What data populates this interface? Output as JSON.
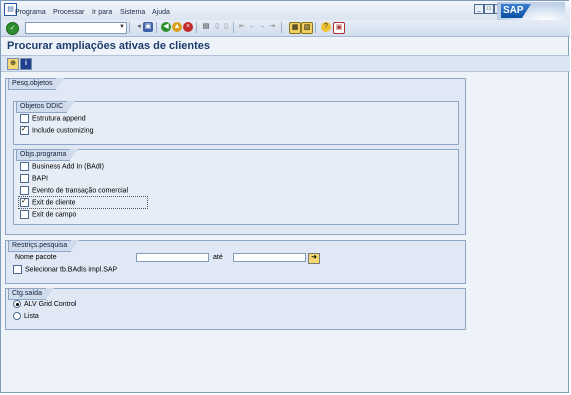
{
  "menubar": {
    "items": [
      {
        "id": "programa",
        "label": "Programa"
      },
      {
        "id": "processar",
        "label": "Processar"
      },
      {
        "id": "irpara",
        "label": "Ir para"
      },
      {
        "id": "sistema",
        "label": "Sistema"
      },
      {
        "id": "ajuda",
        "label": "Ajuda"
      }
    ],
    "logo_text": "SAP"
  },
  "systoolbar": {
    "command_value": "",
    "icons": [
      "enter-icon",
      "save-icon",
      "back-icon",
      "exit-icon",
      "cancel-icon",
      "print-icon",
      "find-icon",
      "find-next-icon",
      "first-page-icon",
      "prev-page-icon",
      "next-page-icon",
      "last-page-icon",
      "create-session-icon",
      "shortcut-icon",
      "help-icon",
      "customize-layout-icon"
    ]
  },
  "title": "Procurar ampliações ativas de clientes",
  "apptoolbar": {
    "icons": [
      "execute-icon",
      "information-icon"
    ]
  },
  "groups": {
    "pesq": {
      "label": "Pesq.objetos",
      "ddic": {
        "label": "Objetos DDIC",
        "options": [
          {
            "label": "Estrutura append",
            "checked": false
          },
          {
            "label": "Include customizing",
            "checked": true
          }
        ]
      },
      "prog": {
        "label": "Objs.programa",
        "options": [
          {
            "label": "Business Add In (BAdI)",
            "checked": false
          },
          {
            "label": "BAPI",
            "checked": false
          },
          {
            "label": "Evento de transação comercial",
            "checked": false
          },
          {
            "label": "Exit de cliente",
            "checked": true
          },
          {
            "label": "Exit de campo",
            "checked": false
          }
        ]
      }
    },
    "restr": {
      "label": "Restriçs.pesquisa",
      "field_label": "Nome pacote",
      "from_value": "",
      "to_label": "até",
      "to_value": "",
      "checkbox": {
        "label": "Selecionar tb.BAdIs impl.SAP",
        "checked": false
      }
    },
    "saida": {
      "label": "Ctg.saída",
      "options": [
        {
          "label": "ALV Grid Control",
          "selected": true
        },
        {
          "label": "Lista",
          "selected": false
        }
      ]
    }
  }
}
